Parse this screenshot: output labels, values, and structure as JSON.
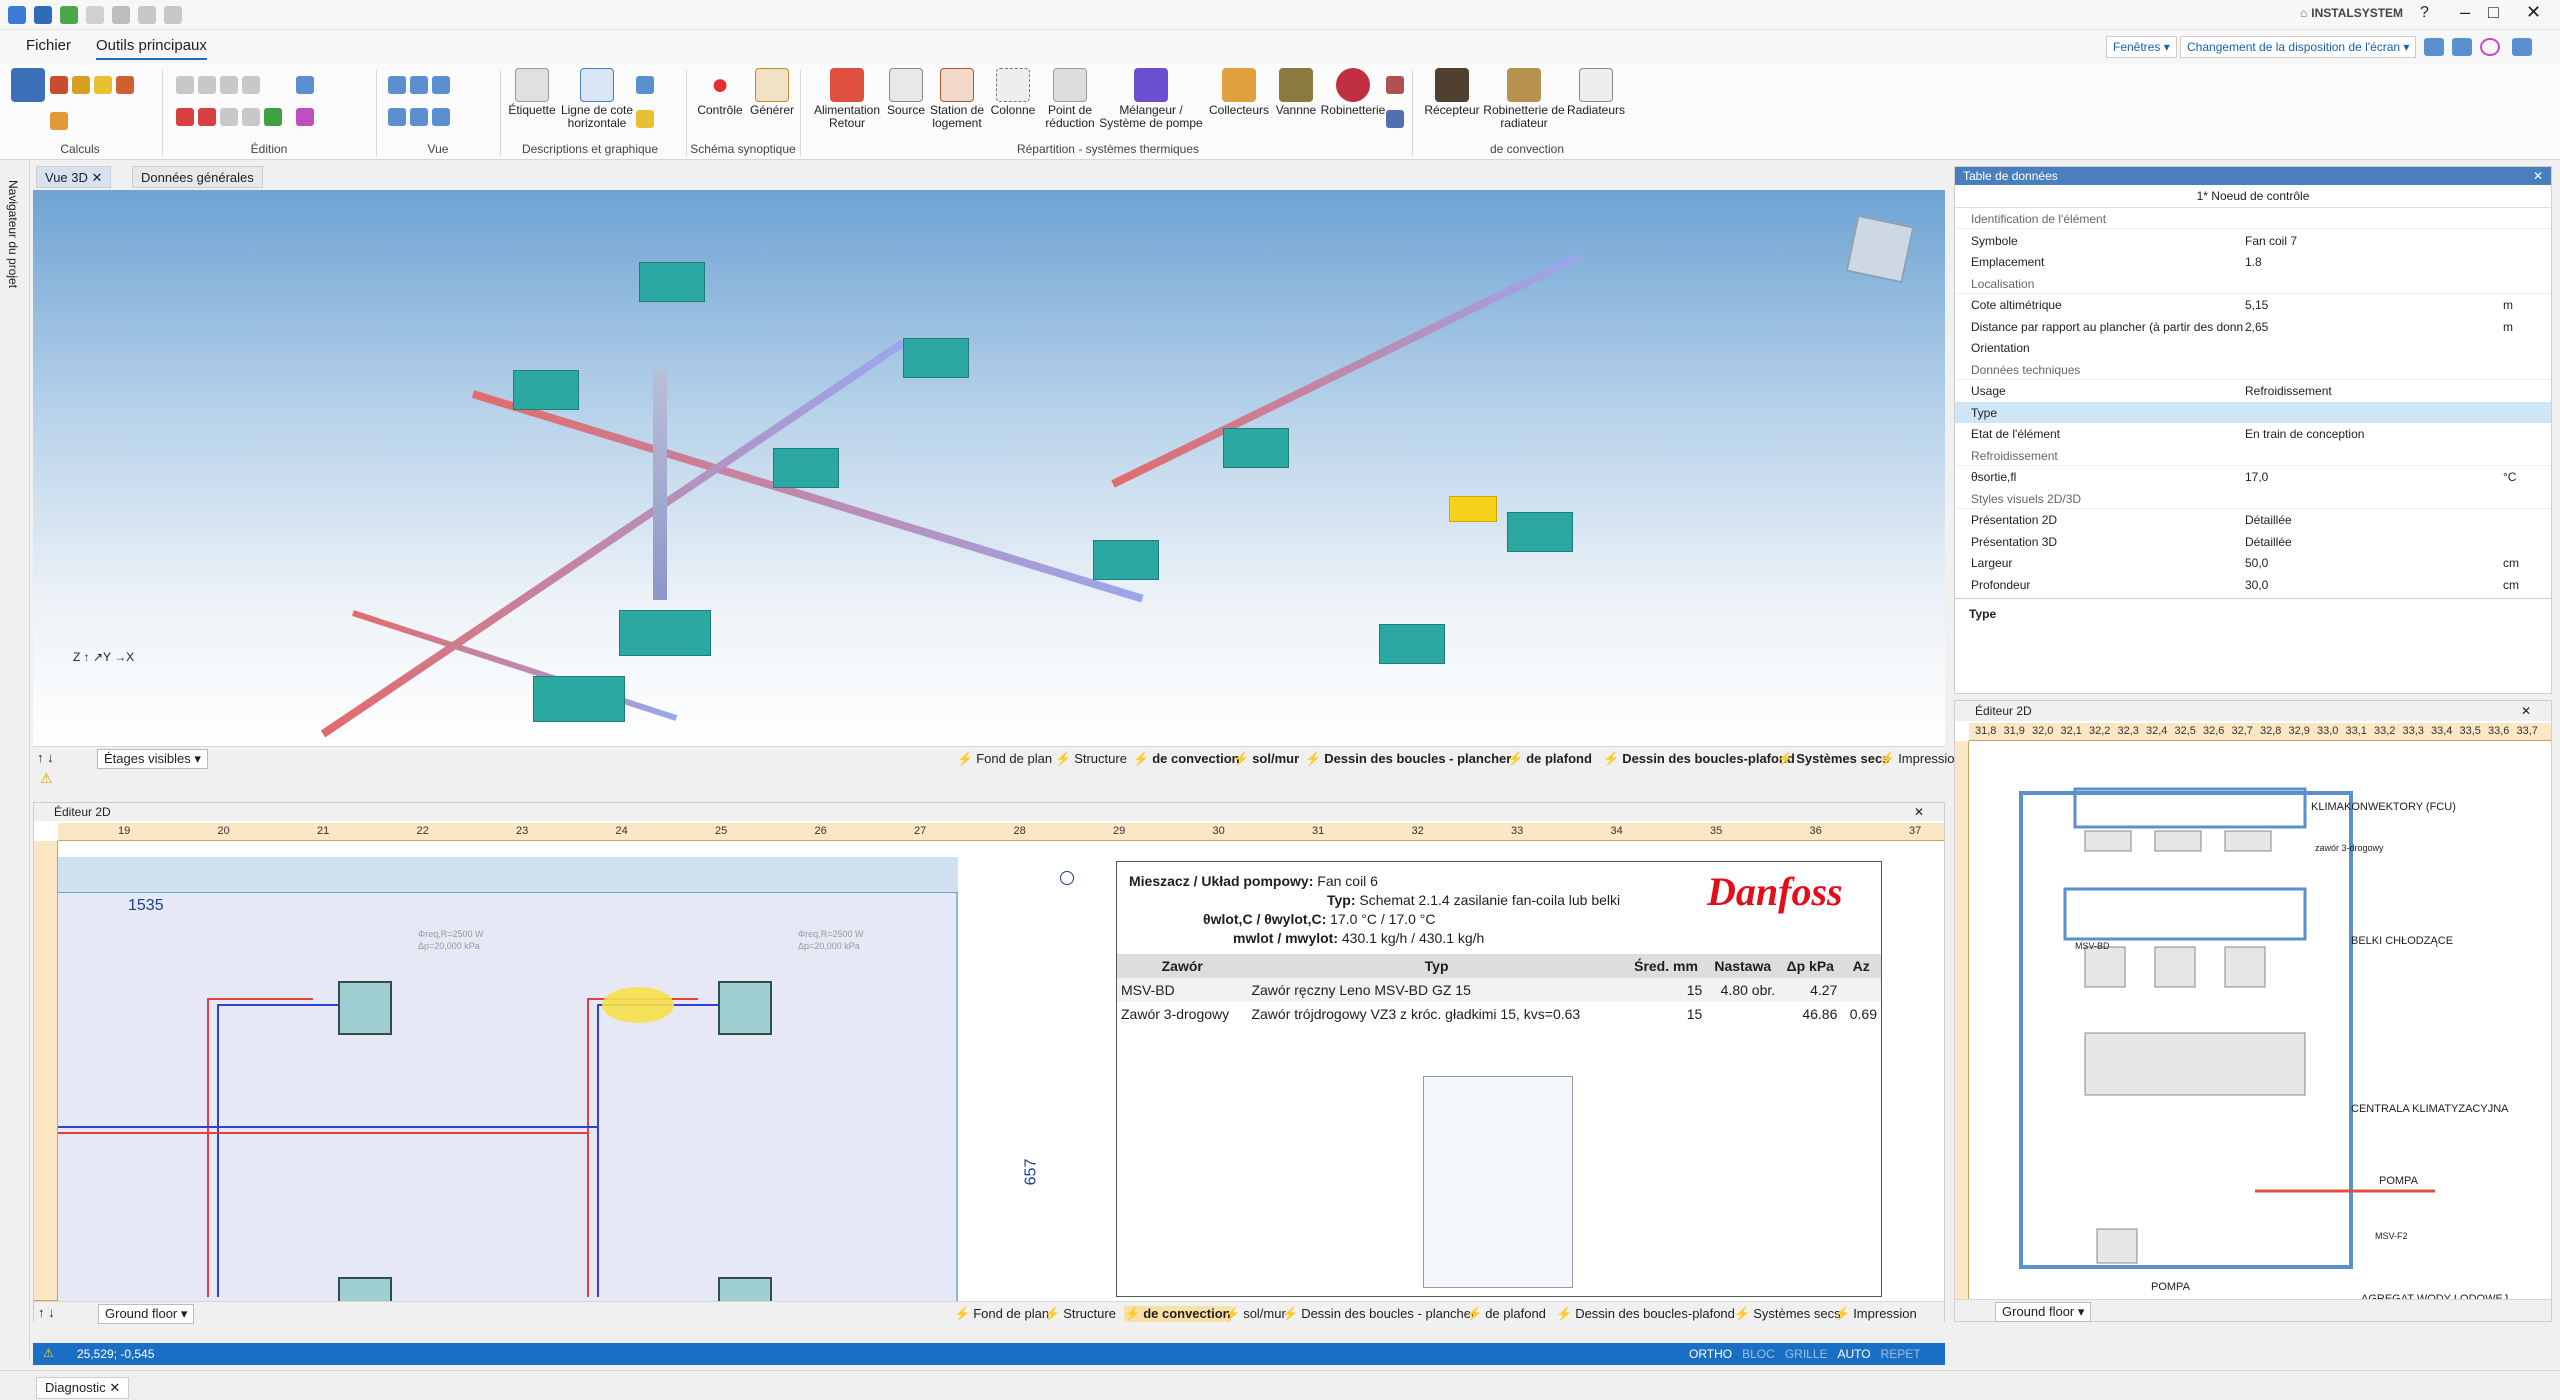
{
  "app": {
    "brand": "INSTALSYSTEM"
  },
  "menu": {
    "file": "Fichier",
    "tools": "Outils principaux"
  },
  "topright": {
    "windows": "Fenêtres",
    "layout": "Changement de la disposition de l'écran"
  },
  "ribbon": {
    "groups": [
      "Calculs",
      "Édition",
      "Vue",
      "Descriptions et graphique",
      "Schéma synoptique",
      "Répartition - systèmes thermiques",
      "de convection"
    ],
    "buttons": [
      "Étiquette",
      "Ligne de cote horizontale",
      "Contrôle",
      "Générer",
      "Alimentation Retour",
      "Source",
      "Station de logement",
      "Colonne",
      "Point de réduction",
      "Mélangeur / Système de pompe",
      "Collecteurs",
      "Vannne",
      "Robinetterie",
      "Récepteur",
      "Robinetterie de radiateur",
      "Radiateurs"
    ]
  },
  "leftnav": {
    "label": "Navigateur du projet"
  },
  "tabs": {
    "view3d": "Vue 3D",
    "general": "Données générales"
  },
  "view3d": {
    "visible_floors": "Étages visibles",
    "layers": [
      "Fond de plan",
      "Structure",
      "de convection",
      "sol/mur",
      "Dessin des boucles - plancher",
      "de plafond",
      "Dessin des boucles-plafond",
      "Systèmes secs",
      "Impression"
    ]
  },
  "datatable": {
    "title": "Table de données",
    "subtitle": "1* Noeud de contrôle",
    "rows": [
      {
        "k": "Identification de l'élément",
        "v": "",
        "u": "",
        "sec": true
      },
      {
        "k": "Symbole",
        "v": "Fan coil 7",
        "u": ""
      },
      {
        "k": "Emplacement",
        "v": "1.8",
        "u": ""
      },
      {
        "k": "Localisation",
        "v": "",
        "u": "",
        "sec": true
      },
      {
        "k": "Cote altimétrique",
        "v": "5,15",
        "u": "m"
      },
      {
        "k": "Distance par rapport au plancher (à partir des donn",
        "v": "2,65",
        "u": "m"
      },
      {
        "k": "Orientation",
        "v": "",
        "u": ""
      },
      {
        "k": "Données techniques",
        "v": "",
        "u": "",
        "sec": true
      },
      {
        "k": "Usage",
        "v": "Refroidissement",
        "u": ""
      },
      {
        "k": "Type",
        "v": "",
        "u": ""
      },
      {
        "k": "Etat de l'élément",
        "v": "En train de conception",
        "u": ""
      },
      {
        "k": "Refroidissement",
        "v": "",
        "u": "",
        "sec": true
      },
      {
        "k": "θsortie,fl",
        "v": "17,0",
        "u": "°C"
      },
      {
        "k": "Styles visuels 2D/3D",
        "v": "",
        "u": "",
        "sec": true
      },
      {
        "k": "Présentation 2D",
        "v": "Détaillée",
        "u": ""
      },
      {
        "k": "Présentation 3D",
        "v": "Détaillée",
        "u": ""
      },
      {
        "k": "Largeur",
        "v": "50,0",
        "u": "cm"
      },
      {
        "k": "Profondeur",
        "v": "30,0",
        "u": "cm"
      }
    ],
    "footer": "Type"
  },
  "editor2d": {
    "title": "Éditeur 2D",
    "floor": "Ground floor",
    "dim": "1535",
    "dim2": "657",
    "ruler": [
      "19",
      "20",
      "21",
      "22",
      "23",
      "24",
      "25",
      "26",
      "27",
      "28",
      "29",
      "30",
      "31",
      "32",
      "33",
      "34",
      "35",
      "36",
      "37"
    ],
    "layers": [
      "Fond de plan",
      "Structure",
      "de convection",
      "sol/mur",
      "Dessin des boucles - plancher",
      "de plafond",
      "Dessin des boucles-plafond",
      "Systèmes secs",
      "Impression"
    ],
    "fc_labels": [
      "Φreq,R=2500 W",
      "Δp=20,000 kPa",
      "Φreq,R=2500 W",
      "Δp=20,000 kPa"
    ]
  },
  "schematic": {
    "header1": "Mieszacz / Układ pompowy:",
    "header1v": "Fan coil 6",
    "typ": "Typ:",
    "typv": "Schemat 2.1.4 zasilanie fan-coila lub belki",
    "temp": "θwlot,C / θwylot,C:",
    "tempv": "17.0 °C / 17.0 °C",
    "flow": "mwlot / mwylot:",
    "flowv": "430.1 kg/h / 430.1 kg/h",
    "brand": "Danfoss",
    "cols": [
      "Zawór",
      "Typ",
      "Śred. mm",
      "Nastawa",
      "Δp kPa",
      "Az"
    ],
    "rows": [
      [
        "MSV-BD",
        "Zawór ręczny  Leno MSV-BD GZ 15",
        "15",
        "4.80 obr.",
        "4.27",
        ""
      ],
      [
        "Zawór 3-drogowy",
        "Zawór trójdrogowy VZ3 z króc. gładkimi 15, kvs=0.63",
        "15",
        "",
        "46.86",
        "0.69"
      ]
    ]
  },
  "right2d": {
    "title": "Éditeur 2D",
    "floor": "Ground floor",
    "ruler": [
      "31,8",
      "31,9",
      "32,0",
      "32,1",
      "32,2",
      "32,3",
      "32,4",
      "32,5",
      "32,6",
      "32,7",
      "32,8",
      "32,9",
      "33,0",
      "33,1",
      "33,2",
      "33,3",
      "33,4",
      "33,5",
      "33,6",
      "33,7"
    ],
    "labels": [
      "KLIMAKONWEKTORY (FCU)",
      "BELKI CHŁODZĄCE",
      "CENTRALA KLIMATYZACYJNA",
      "POMPA",
      "POMPA",
      "AGREGAT WODY LODOWEJ",
      "MSV-BD",
      "zawór 3-drogowy",
      "MSV-F2"
    ]
  },
  "status": {
    "coords": "25,529; -0,545",
    "modes": [
      "ORTHO",
      "BLOC",
      "GRILLE",
      "AUTO",
      "REPET"
    ]
  },
  "diag": {
    "label": "Diagnostic"
  }
}
